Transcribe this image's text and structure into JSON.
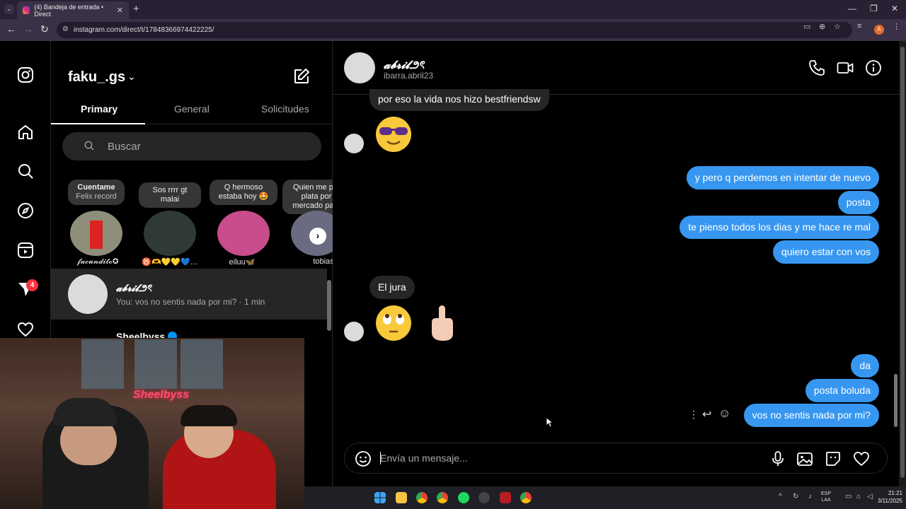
{
  "browser": {
    "tab_title": "(4) Bandeja de entrada • Direct",
    "url": "instagram.com/direct/t/17848366974422225/",
    "profile_initial": "A",
    "new_tab": "+",
    "close": "✕"
  },
  "nav": {
    "notifications_badge": "4",
    "icons": [
      "instagram-icon",
      "home-icon",
      "search-icon",
      "explore-icon",
      "reels-icon",
      "messages-icon",
      "heart-icon"
    ]
  },
  "inbox": {
    "username": "faku_.gs",
    "tabs": [
      "Primary",
      "General",
      "Solicitudes"
    ],
    "search_placeholder": "Buscar",
    "notes": [
      {
        "text_bold": "Cuentame",
        "text": "Felix record",
        "name": "𝓯𝓪𝓬𝓾𝓷𝓭𝓲𝓽𝓸✪"
      },
      {
        "text": "Sos rrrr gt malai",
        "name": "♉🫶💛💛💙…"
      },
      {
        "text": "Q hermoso estaba hoy 🤩",
        "name": "eiluu🦋"
      },
      {
        "text": "Quien me p... plata por mercado pa...",
        "name": "tobias"
      }
    ],
    "conversations": [
      {
        "name": "𝓪𝓫𝓻𝓲𝓵౨ৎ",
        "preview": "You: vos no sentis nada por mi? · 1 min"
      },
      {
        "name": "Sheelbyss",
        "preview": ""
      }
    ]
  },
  "webcam": {
    "neon": "Sheelbyss"
  },
  "chat": {
    "name": "𝓪𝓫𝓻𝓲𝓵౨ৎ",
    "username": "ibarra.abril23",
    "messages_them_top": "por eso la vida nos hizo bestfriendsw",
    "messages_me_1": [
      "y pero q perdemos en intentar de nuevo",
      "posta",
      "te pienso todos los dias y me hace re mal",
      "quiero estar con vos"
    ],
    "message_them_2": "El jura",
    "messages_me_2": [
      "da",
      "posta boluda",
      "vos no sentis nada por mi?"
    ],
    "composer_placeholder": "Envía un mensaje...",
    "action_more": "⋮",
    "action_reply": "↩",
    "action_react": "☺"
  },
  "taskbar": {
    "lang": "ESP",
    "lang2": "LAA",
    "time": "21:21",
    "date": "3/11/2025"
  }
}
